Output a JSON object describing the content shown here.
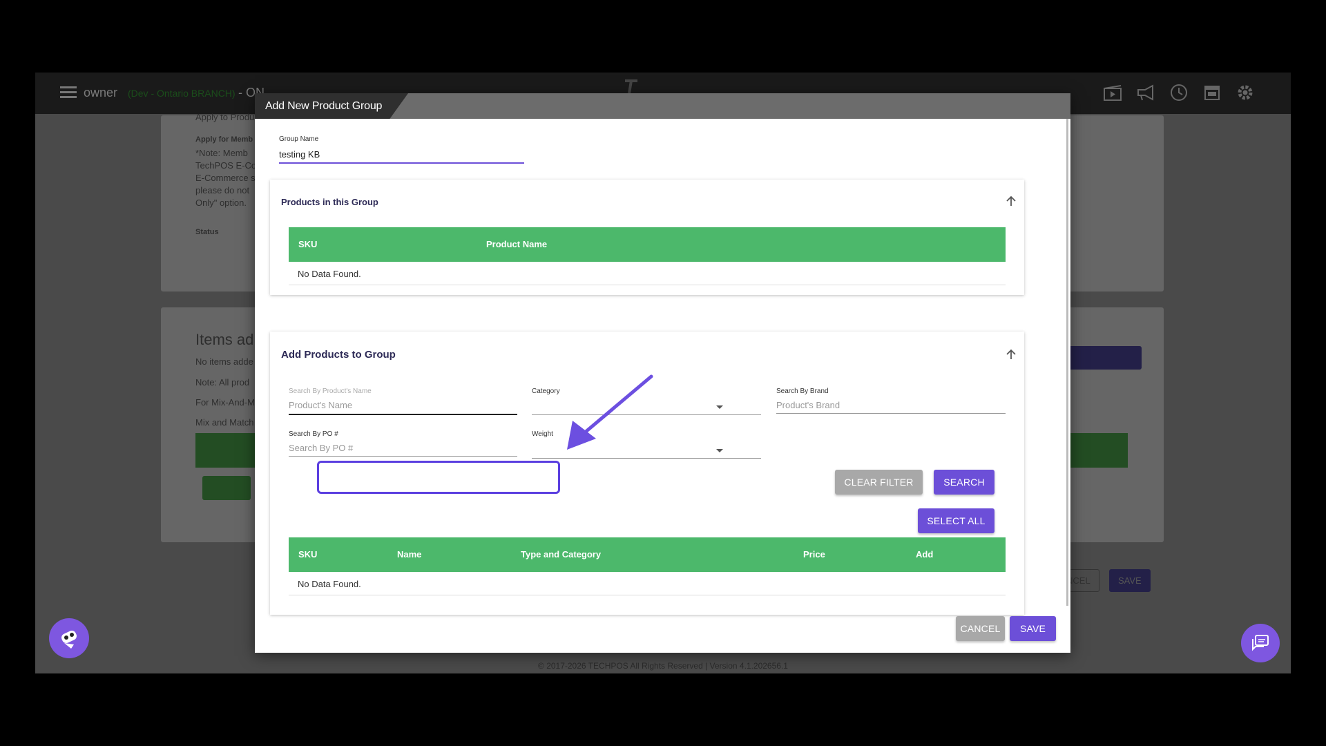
{
  "topbar": {
    "user": "owner",
    "branch": "(Dev - Ontario BRANCH)",
    "status": "- ON",
    "logo_text": "TECHPOS",
    "icons": [
      "video-icon",
      "megaphone-icon",
      "clock-icon",
      "store-icon",
      "gear-icon"
    ]
  },
  "background": {
    "apply_text": "Apply to Produ",
    "apply_member_label": "Apply for Memb",
    "note_lines": [
      "*Note: Memb",
      "TechPOS E-Co",
      "E-Commerce s",
      "please do not",
      "Only\" option."
    ],
    "status_label": "Status",
    "items_heading": "Items ad",
    "items_lines": [
      "No items adde",
      "Note: All prod",
      "For Mix-And-M",
      "Mix and Match"
    ],
    "cancel_label": "NCEL",
    "save_label": "SAVE",
    "footer": "© 2017-2026 TECHPOS All Rights Reserved | Version 4.1.202656.1"
  },
  "modal": {
    "title": "Add New Product Group",
    "group_name": {
      "label": "Group Name",
      "value": "testing KB"
    },
    "products_in_group": {
      "title": "Products in this Group",
      "columns": [
        "SKU",
        "Product Name"
      ],
      "empty": "No Data Found."
    },
    "add_products": {
      "title": "Add Products to Group",
      "search_name": {
        "label": "Search By Product's Name",
        "placeholder": "Product's Name"
      },
      "category": {
        "label": "Category",
        "value": ""
      },
      "brand": {
        "label": "Search By Brand",
        "placeholder": "Product's Brand"
      },
      "po": {
        "label": "Search By PO #",
        "placeholder": "Search By PO #"
      },
      "weight": {
        "label": "Weight",
        "value": ""
      },
      "clear_filter": "CLEAR FILTER",
      "search": "SEARCH",
      "select_all": "SELECT ALL",
      "columns": [
        "SKU",
        "Name",
        "Type and Category",
        "Price",
        "Add"
      ],
      "empty": "No Data Found."
    },
    "cancel": "CANCEL",
    "save": "SAVE"
  },
  "colors": {
    "accent": "#6c4fd8",
    "table_header": "#4cb86b",
    "highlight": "#5b3fe0"
  }
}
